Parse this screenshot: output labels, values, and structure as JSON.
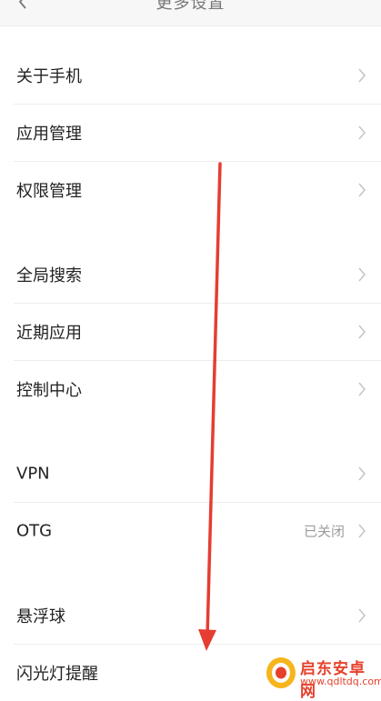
{
  "header": {
    "title": "更多设置",
    "back_icon": "back-chevron-icon"
  },
  "groups": [
    {
      "items": [
        {
          "label": "关于手机",
          "value": ""
        },
        {
          "label": "应用管理",
          "value": ""
        },
        {
          "label": "权限管理",
          "value": ""
        }
      ]
    },
    {
      "items": [
        {
          "label": "全局搜索",
          "value": ""
        },
        {
          "label": "近期应用",
          "value": ""
        },
        {
          "label": "控制中心",
          "value": ""
        }
      ]
    },
    {
      "items": [
        {
          "label": "VPN",
          "value": ""
        },
        {
          "label": "OTG",
          "value": "已关闭"
        }
      ]
    },
    {
      "items": [
        {
          "label": "悬浮球",
          "value": ""
        },
        {
          "label": "闪光灯提醒",
          "value": ""
        }
      ]
    }
  ],
  "annotation": {
    "arrow_color": "#e53d32"
  },
  "watermark": {
    "text": "启东安卓网",
    "url": "www.qdltdq.com",
    "color": "#e6412b"
  }
}
